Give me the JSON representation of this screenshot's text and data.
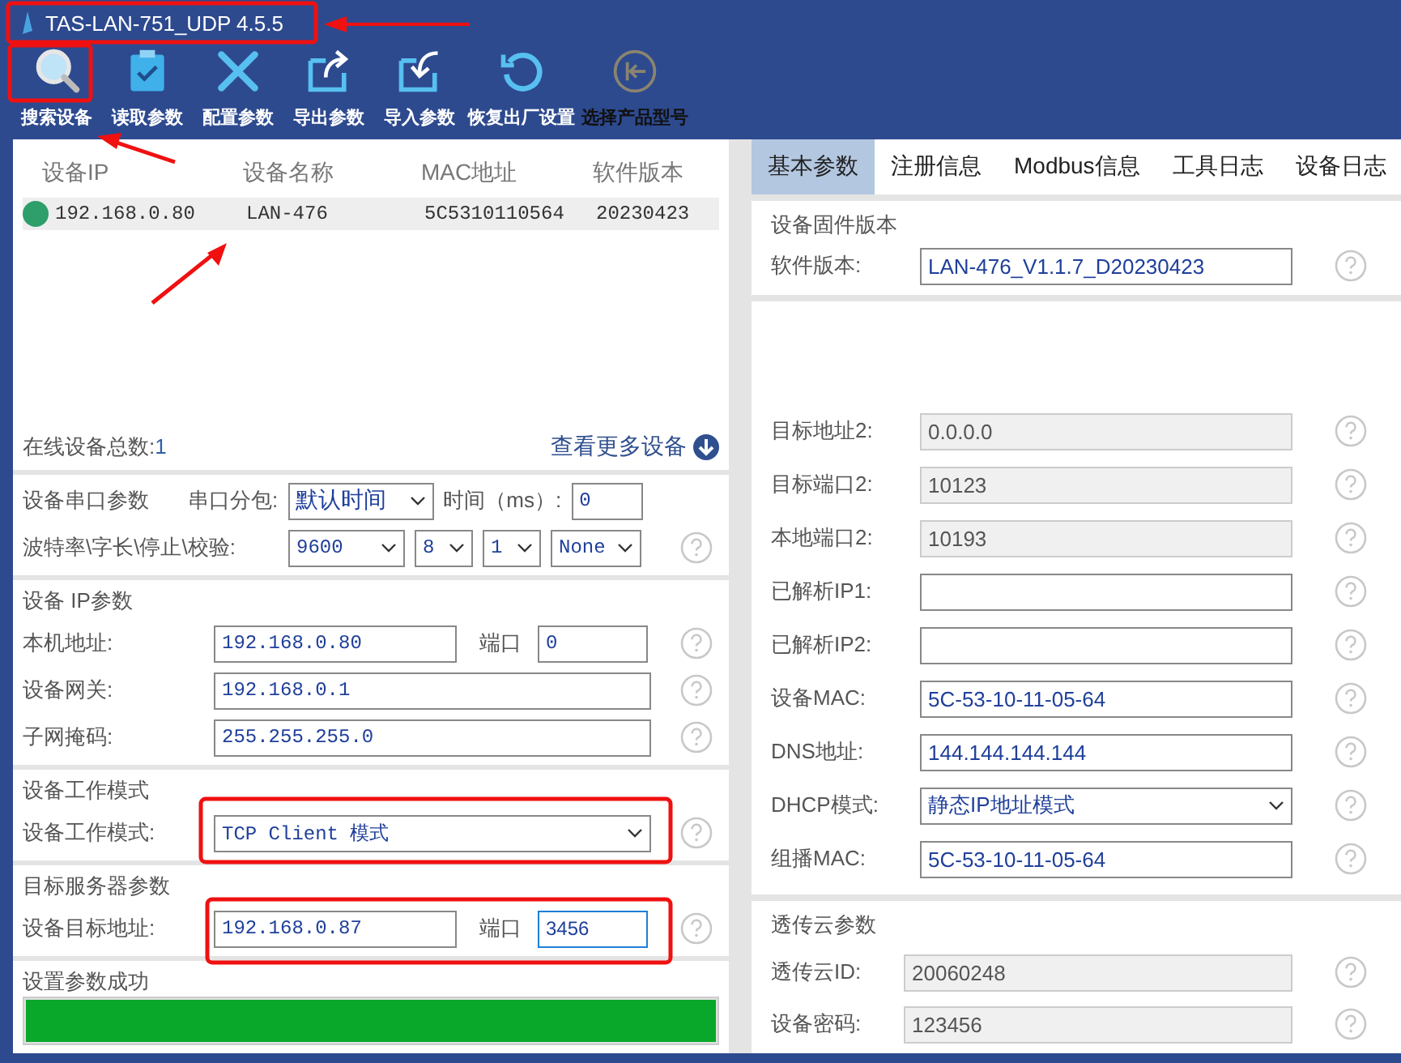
{
  "window": {
    "title": "TAS-LAN-751_UDP 4.5.5"
  },
  "toolbar": [
    {
      "kind": "search",
      "label": "搜索设备",
      "disabled": false
    },
    {
      "kind": "read",
      "label": "读取参数",
      "disabled": false
    },
    {
      "kind": "config",
      "label": "配置参数",
      "disabled": false
    },
    {
      "kind": "export",
      "label": "导出参数",
      "disabled": false
    },
    {
      "kind": "import",
      "label": "导入参数",
      "disabled": false
    },
    {
      "kind": "reset",
      "label": "恢复出厂设置",
      "disabled": false
    },
    {
      "kind": "product",
      "label": "选择产品型号",
      "disabled": true
    }
  ],
  "device_list": {
    "columns": [
      "设备IP",
      "设备名称",
      "MAC地址",
      "软件版本"
    ],
    "rows": [
      {
        "online": true,
        "selected": true,
        "cells": [
          "192.168.0.80",
          "LAN-476",
          "5C5310110564",
          "20230423"
        ]
      }
    ],
    "total_label": "在线设备总数:",
    "total": "1",
    "more_link": "查看更多设备"
  },
  "serial": {
    "title": "设备串口参数",
    "packet_label": "串口分包:",
    "packet_value": "默认时间",
    "time_label": "时间（ms）:",
    "time_value": "0",
    "uart_label": "波特率\\字长\\停止\\校验:",
    "uart_values": [
      "9600",
      "8",
      "1",
      "None"
    ]
  },
  "ip": {
    "title": "设备 IP参数",
    "rows": [
      {
        "label": "本机地址:",
        "value": "192.168.0.80",
        "port_label": "端口",
        "port": "0"
      },
      {
        "label": "设备网关:",
        "value": "192.168.0.1"
      },
      {
        "label": "子网掩码:",
        "value": "255.255.255.0"
      }
    ]
  },
  "work_mode": {
    "title": "设备工作模式",
    "label": "设备工作模式:",
    "value": "TCP Client 模式"
  },
  "target": {
    "title": "目标服务器参数",
    "label": "设备目标地址:",
    "value": "192.168.0.87",
    "port_label": "端口",
    "port": "3456",
    "port_focused": true
  },
  "status": {
    "text": "设置参数成功",
    "level": 1
  },
  "tabs": [
    {
      "label": "基本参数",
      "selected": true
    },
    {
      "label": "注册信息",
      "selected": false
    },
    {
      "label": "Modbus信息",
      "selected": false
    },
    {
      "label": "工具日志",
      "selected": false
    },
    {
      "label": "设备日志",
      "selected": false
    }
  ],
  "firmware": {
    "title": "设备固件版本",
    "label": "软件版本:",
    "value": "LAN-476_V1.1.7_D20230423"
  },
  "fields": [
    {
      "kind": "text",
      "label": "目标地址2:",
      "value": "0.0.0.0",
      "disabled": true
    },
    {
      "kind": "text",
      "label": "目标端口2:",
      "value": "10123",
      "disabled": true
    },
    {
      "kind": "text",
      "label": "本地端口2:",
      "value": "10193",
      "disabled": true
    },
    {
      "kind": "text",
      "label": "已解析IP1:",
      "disabled": false
    },
    {
      "kind": "text",
      "label": "已解析IP2:",
      "disabled": false
    },
    {
      "kind": "text",
      "label": "设备MAC:",
      "value": "5C-53-10-11-05-64",
      "disabled": false
    },
    {
      "kind": "text",
      "label": "DNS地址:",
      "value": "144.144.144.144",
      "disabled": false
    },
    {
      "kind": "select",
      "label": "DHCP模式:",
      "value": "静态IP地址模式",
      "disabled": false
    },
    {
      "kind": "text",
      "label": "组播MAC:",
      "value": "5C-53-10-11-05-64",
      "disabled": false
    }
  ],
  "cloud": {
    "title": "透传云参数",
    "fields": [
      {
        "label": "透传云ID:",
        "value": "20060248",
        "disabled": true
      },
      {
        "label": "设备密码:",
        "value": "123456",
        "disabled": true
      }
    ]
  }
}
